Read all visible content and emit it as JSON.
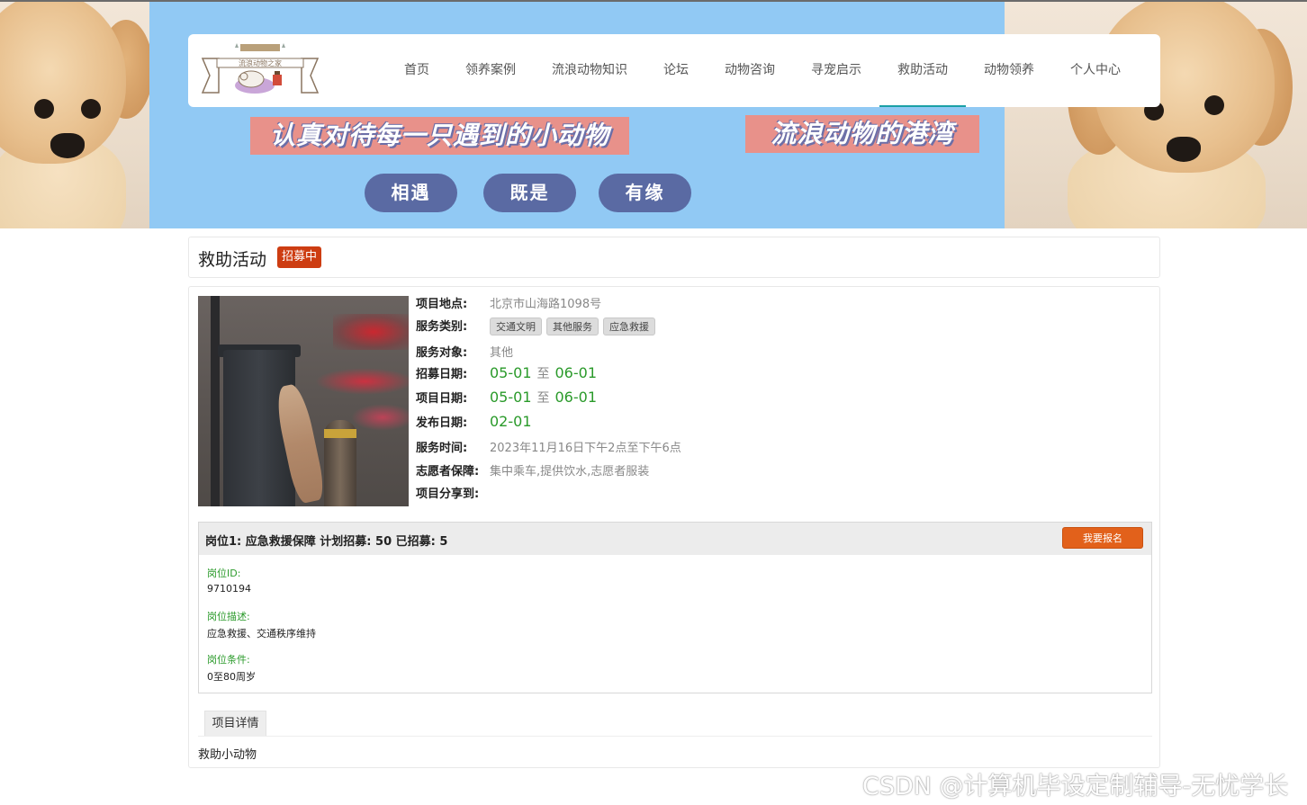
{
  "banner": {
    "slogan_left": "认真对待每一只遇到的小动物",
    "slogan_right": "流浪动物的港湾",
    "pills": [
      "相遇",
      "既是",
      "有缘"
    ],
    "logo_text": "流浪动物之家"
  },
  "nav": {
    "items": [
      "首页",
      "领养案例",
      "流浪动物知识",
      "论坛",
      "动物咨询",
      "寻宠启示",
      "救助活动",
      "动物领养",
      "个人中心"
    ],
    "active": "救助活动"
  },
  "page": {
    "title": "救助活动",
    "status_badge": "招募中"
  },
  "project": {
    "location_label": "项目地点:",
    "location": "北京市山海路1098号",
    "category_label": "服务类别:",
    "categories": [
      "交通文明",
      "其他服务",
      "应急救援"
    ],
    "target_label": "服务对象:",
    "target": "其他",
    "recruit_label": "招募日期:",
    "recruit_start": "05-01",
    "recruit_end": "06-01",
    "project_date_label": "项目日期:",
    "project_start": "05-01",
    "project_end": "06-01",
    "to_text": "至",
    "publish_label": "发布日期:",
    "publish_date": "02-01",
    "service_time_label": "服务时间:",
    "service_time": "2023年11月16日下午2点至下午6点",
    "guarantee_label": "志愿者保障:",
    "guarantee": "集中乘车,提供饮水,志愿者服装",
    "share_label": "项目分享到:"
  },
  "position": {
    "header": "岗位1: 应急救援保障   计划招募: 50   已招募: 5",
    "signup_button": "我要报名",
    "id_label": "岗位ID:",
    "id_value": "9710194",
    "desc_label": "岗位描述:",
    "desc_value": "应急救援、交通秩序维持",
    "cond_label": "岗位条件:",
    "cond_value": "0至80周岁"
  },
  "detail": {
    "tab_label": "项目详情",
    "content": "救助小动物"
  },
  "watermark": "CSDN @计算机毕设定制辅导-无忧学长",
  "colors": {
    "banner_blue": "#91c9f4",
    "slogan_bg": "#e8918a",
    "pill_bg": "#5a6aa3",
    "badge_red": "#cd3d12",
    "date_green": "#2a9a2a",
    "signup_orange": "#e2611b",
    "nav_active_line": "#1aa0a6"
  }
}
